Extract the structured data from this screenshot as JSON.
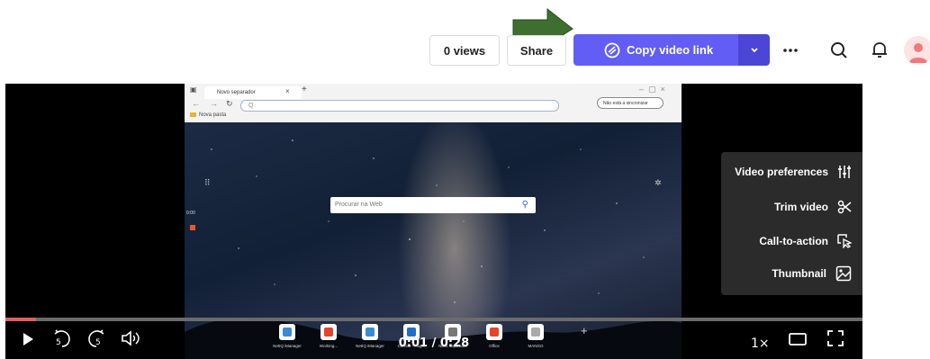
{
  "header": {
    "views_label": "0 views",
    "share_label": "Share",
    "copy_link_label": "Copy video link",
    "colors": {
      "primary": "#625df5",
      "primary_dark": "#4b46d6",
      "arrow": "#3f6f2e"
    }
  },
  "recording": {
    "tab_title": "Novo separador",
    "address_placeholder": "Q",
    "bookmark": "Nova pasta",
    "signin_label": "Não está a sincronizar",
    "web_search_placeholder": "Procurar na Web",
    "timestamp": "0:00",
    "tiles": [
      {
        "label": "NetIQ iManager",
        "color": "#3a8bd6"
      },
      {
        "label": "Working...",
        "color": "#e8432a"
      },
      {
        "label": "NetIQ iManager",
        "color": "#3a8bd6"
      },
      {
        "label": "Correio - Hug...",
        "color": "#1f6fc9"
      },
      {
        "label": "Novo separador",
        "color": "#777777"
      },
      {
        "label": "Office",
        "color": "#e8432a"
      },
      {
        "label": "MANGO",
        "color": "#aaaaaa"
      }
    ]
  },
  "side_panel": {
    "items": [
      {
        "label": "Video preferences",
        "icon": "sliders-icon"
      },
      {
        "label": "Trim video",
        "icon": "scissors-icon"
      },
      {
        "label": "Call-to-action",
        "icon": "cursor-click-icon"
      },
      {
        "label": "Thumbnail",
        "icon": "image-icon"
      }
    ]
  },
  "player": {
    "current_time": "0:01",
    "duration": "0:28",
    "time_display": "0:01 / 0:28",
    "progress_fraction": 0.0357,
    "speed": "1×",
    "rewind_seconds": "5",
    "forward_seconds": "5"
  }
}
